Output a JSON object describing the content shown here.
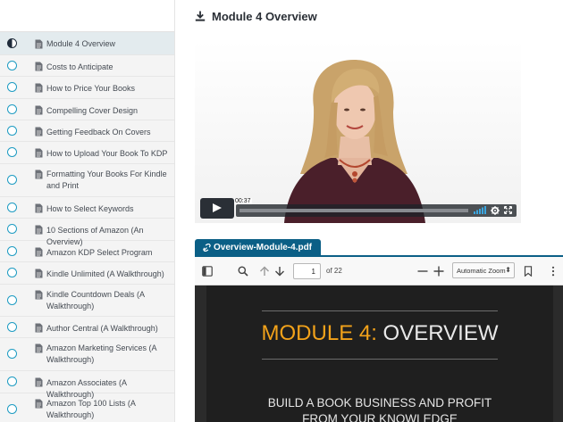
{
  "page": {
    "title": "Module 4 Overview"
  },
  "lessons": [
    {
      "label": "Module 4 Overview",
      "status": "in-progress"
    },
    {
      "label": "Costs to Anticipate",
      "status": "not-started"
    },
    {
      "label": "How to Price Your Books",
      "status": "not-started"
    },
    {
      "label": "Compelling Cover Design",
      "status": "not-started"
    },
    {
      "label": "Getting Feedback On Covers",
      "status": "not-started"
    },
    {
      "label": "How to Upload Your Book To KDP",
      "status": "not-started"
    },
    {
      "label": "Formatting Your Books For Kindle and Print",
      "status": "not-started"
    },
    {
      "label": "How to Select Keywords",
      "status": "not-started"
    },
    {
      "label": "10 Sections of Amazon (An Overview)",
      "status": "not-started"
    },
    {
      "label": "Amazon KDP Select Program",
      "status": "not-started"
    },
    {
      "label": "Kindle Unlimited (A Walkthrough)",
      "status": "not-started"
    },
    {
      "label": "Kindle Countdown Deals (A Walkthrough)",
      "status": "not-started"
    },
    {
      "label": "Author Central (A Walkthrough)",
      "status": "not-started"
    },
    {
      "label": "Amazon Marketing Services (A Walkthrough)",
      "status": "not-started"
    },
    {
      "label": "Amazon Associates (A Walkthrough)",
      "status": "not-started"
    },
    {
      "label": "Amazon Top 100 Lists (A Walkthrough)",
      "status": "not-started"
    }
  ],
  "video": {
    "time": "00:37",
    "progress": 0.0
  },
  "attachment": {
    "tab_label": "Overview-Module-4.pdf"
  },
  "pdf_toolbar": {
    "page_number": "1",
    "page_count": "of 22",
    "zoom": "Automatic Zoom"
  },
  "pdf_page": {
    "heading_part1": "MODULE 4:",
    "heading_part2": " OVERVIEW",
    "subheading_line1": "BUILD A BOOK BUSINESS AND PROFIT",
    "subheading_line2": "FROM YOUR KNOWLEDGE"
  },
  "colors": {
    "accent": "#1d9bc2",
    "tab": "#0b5f86",
    "highlight": "#f2a21a"
  }
}
